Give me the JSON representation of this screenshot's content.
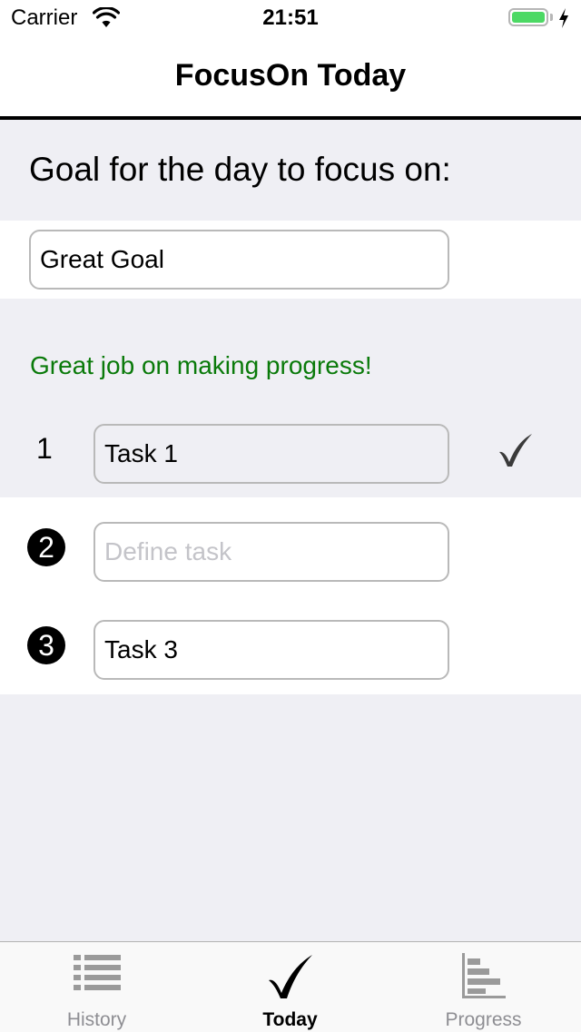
{
  "status_bar": {
    "carrier": "Carrier",
    "time": "21:51",
    "battery_level": 1.0
  },
  "nav": {
    "title": "FocusOn Today"
  },
  "goal": {
    "header": "Goal for the day to focus on:",
    "value": "Great Goal"
  },
  "progress_message": "Great job on making progress!",
  "tasks": [
    {
      "number": "1",
      "value": "Task 1",
      "placeholder": "",
      "completed": true
    },
    {
      "number": "2",
      "value": "",
      "placeholder": "Define task",
      "completed": false
    },
    {
      "number": "3",
      "value": "Task 3",
      "placeholder": "",
      "completed": false
    }
  ],
  "tab_bar": {
    "items": [
      {
        "label": "History",
        "icon": "list-icon",
        "active": false
      },
      {
        "label": "Today",
        "icon": "checkmark-icon",
        "active": true
      },
      {
        "label": "Progress",
        "icon": "bar-chart-icon",
        "active": false
      }
    ]
  },
  "colors": {
    "success_text": "#0a7a0a",
    "battery": "#4cd964",
    "background": "#efeff4"
  }
}
